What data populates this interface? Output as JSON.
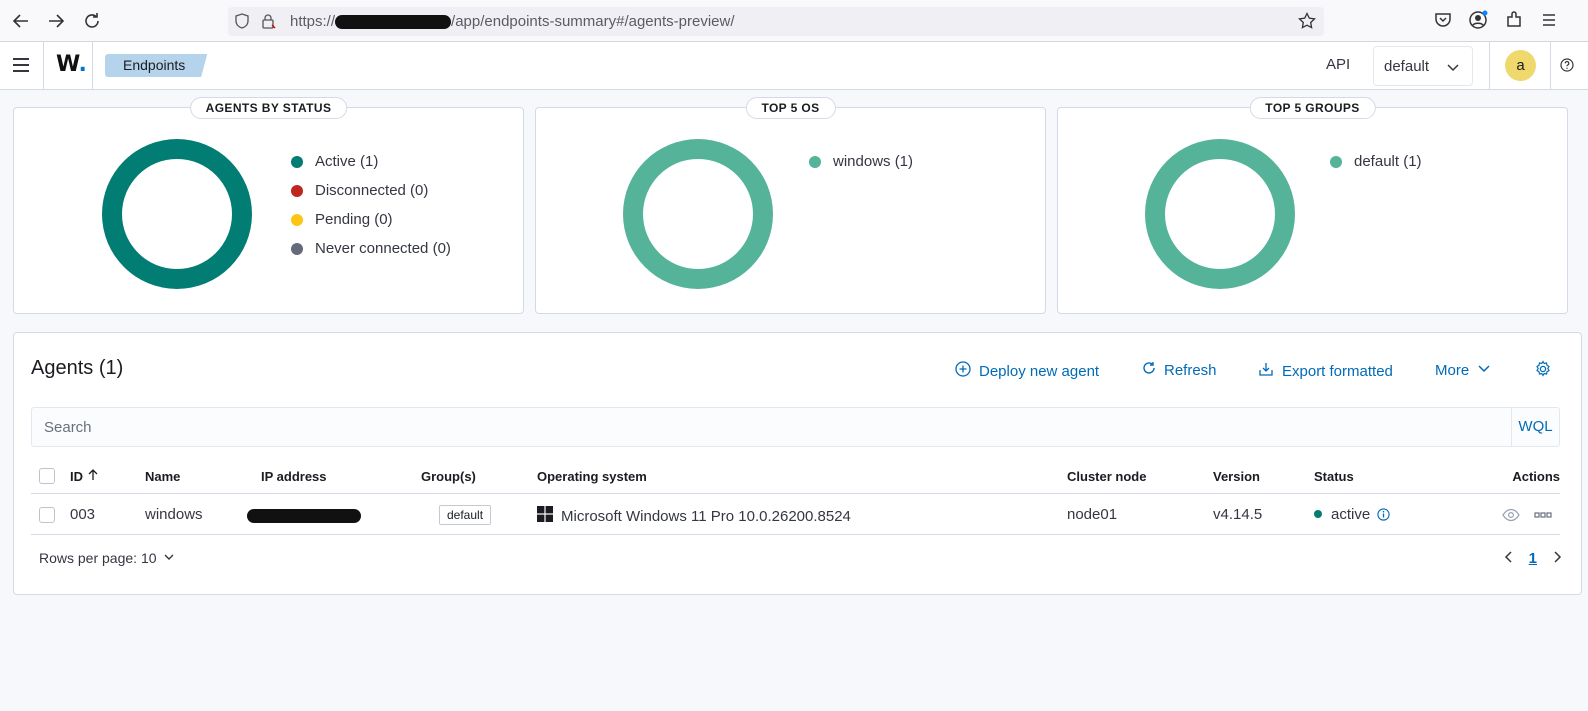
{
  "browser": {
    "url_prefix": "https://",
    "url_suffix": "/app/endpoints-summary#/agents-preview/"
  },
  "header": {
    "logo": "W",
    "breadcrumb": "Endpoints",
    "api_label": "API",
    "api_selected": "default",
    "avatar_initial": "a"
  },
  "cards": {
    "status": {
      "title": "AGENTS BY STATUS",
      "legend": [
        {
          "label": "Active (1)",
          "color": "#017d73"
        },
        {
          "label": "Disconnected (0)",
          "color": "#bd271e"
        },
        {
          "label": "Pending (0)",
          "color": "#fec514"
        },
        {
          "label": "Never connected (0)",
          "color": "#646a77"
        }
      ]
    },
    "os": {
      "title": "TOP 5 OS",
      "legend": [
        {
          "label": "windows (1)",
          "color": "#54b399"
        }
      ]
    },
    "groups": {
      "title": "TOP 5 GROUPS",
      "legend": [
        {
          "label": "default (1)",
          "color": "#54b399"
        }
      ]
    }
  },
  "agents": {
    "title": "Agents (1)",
    "actions": {
      "deploy": "Deploy new agent",
      "refresh": "Refresh",
      "export": "Export formatted",
      "more": "More"
    },
    "search_placeholder": "Search",
    "wql": "WQL",
    "columns": {
      "id": "ID",
      "name": "Name",
      "ip": "IP address",
      "groups": "Group(s)",
      "os": "Operating system",
      "cluster": "Cluster node",
      "version": "Version",
      "status": "Status",
      "actions": "Actions"
    },
    "rows": [
      {
        "id": "003",
        "name": "windows",
        "group": "default",
        "os": "Microsoft Windows 11 Pro 10.0.26200.8524",
        "cluster": "node01",
        "version": "v4.14.5",
        "status": "active"
      }
    ],
    "rows_per_page": "Rows per page: 10",
    "current_page": "1"
  }
}
